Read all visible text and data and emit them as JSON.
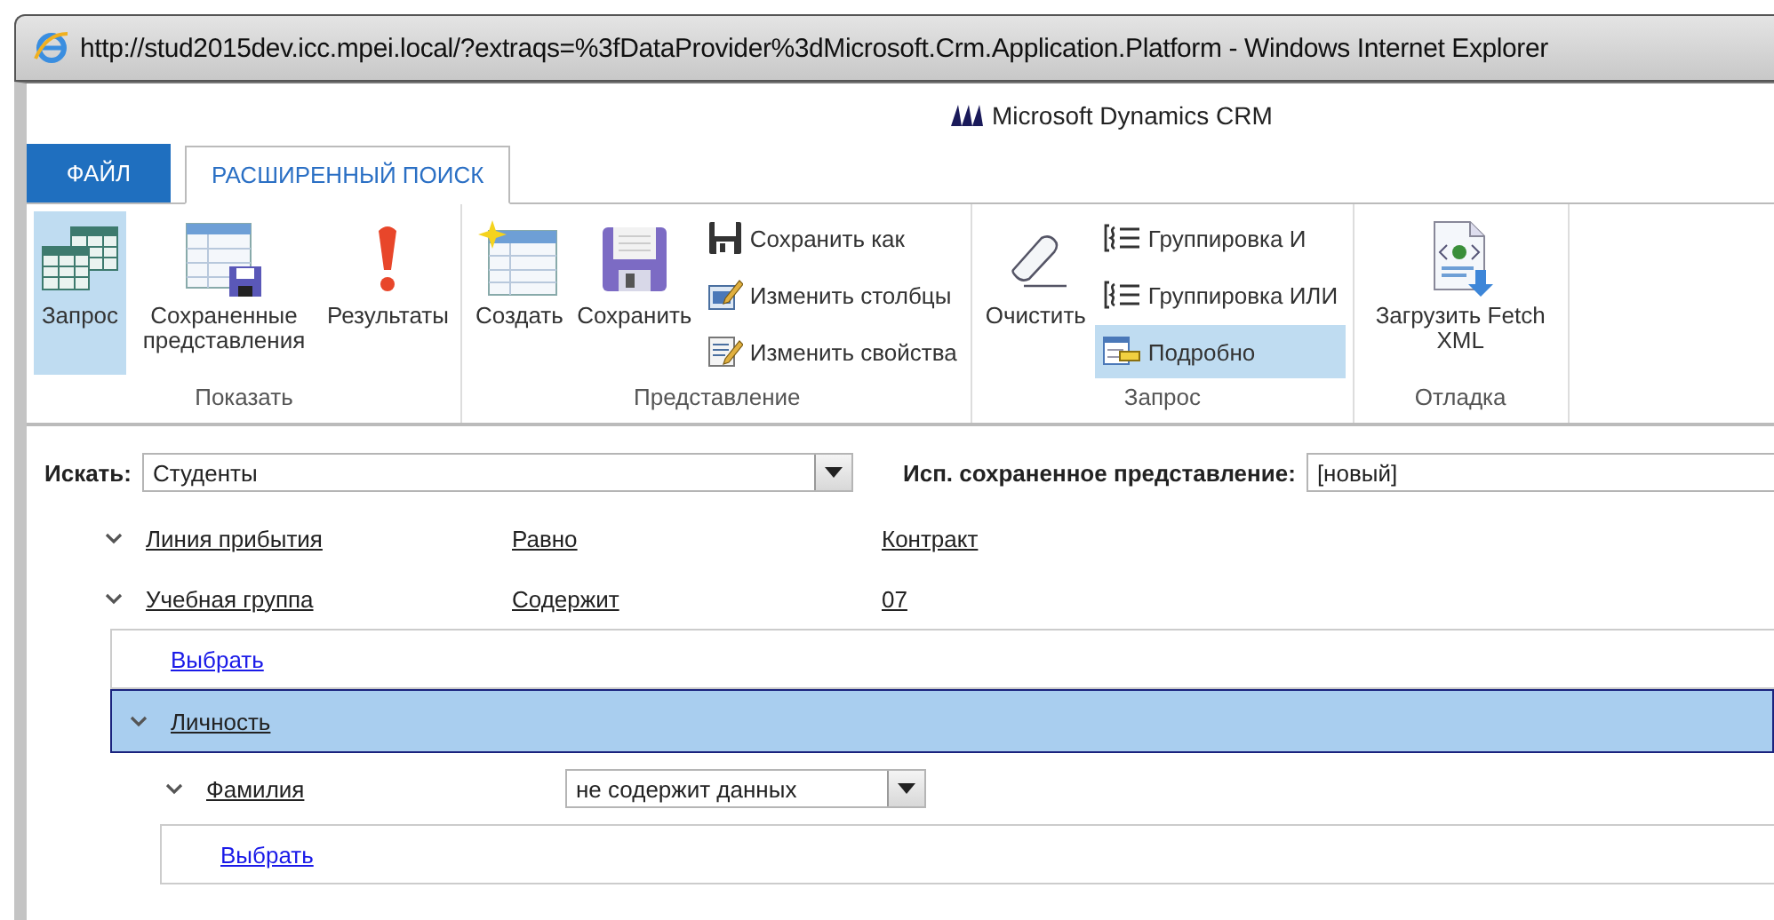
{
  "window": {
    "title": "http://stud2015dev.icc.mpei.local/?extraqs=%3fDataProvider%3dMicrosoft.Crm.Application.Platform - Windows Internet Explorer"
  },
  "header": {
    "logo": "Microsoft Dynamics CRM"
  },
  "tabs": [
    {
      "label": "ФАЙЛ",
      "kind": "file",
      "selected": false
    },
    {
      "label": "РАСШИРЕННЫЙ ПОИСК",
      "kind": "tab",
      "selected": true
    }
  ],
  "ribbon": {
    "groups": [
      {
        "label": "Показать",
        "buttons": [
          {
            "kind": "large",
            "label": "Запрос",
            "selected": true
          },
          {
            "kind": "large",
            "label": "Сохраненные представления",
            "selected": false
          },
          {
            "kind": "large",
            "label": "Результаты",
            "selected": false
          }
        ]
      },
      {
        "label": "Представление",
        "buttons": [
          {
            "kind": "large",
            "label": "Создать",
            "selected": false
          },
          {
            "kind": "large",
            "label": "Сохранить",
            "selected": false
          },
          {
            "kind": "small",
            "label": "Сохранить как",
            "selected": false
          },
          {
            "kind": "small",
            "label": "Изменить столбцы",
            "selected": false
          },
          {
            "kind": "small",
            "label": "Изменить свойства",
            "selected": false
          }
        ]
      },
      {
        "label": "Запрос",
        "buttons": [
          {
            "kind": "large",
            "label": "Очистить",
            "selected": false
          },
          {
            "kind": "small",
            "label": "Группировка И",
            "selected": false
          },
          {
            "kind": "small",
            "label": "Группировка ИЛИ",
            "selected": false
          },
          {
            "kind": "small",
            "label": "Подробно",
            "selected": true
          }
        ]
      },
      {
        "label": "Отладка",
        "buttons": [
          {
            "kind": "large",
            "label": "Загрузить Fetch XML",
            "selected": false
          }
        ]
      }
    ]
  },
  "search": {
    "label": "Искать:",
    "value": "Студенты",
    "saved_view_label": "Исп. сохраненное представление:",
    "saved_view_value": "[новый]"
  },
  "query": {
    "rows": [
      {
        "kind": "link",
        "field": "Линия прибытия",
        "operator": "Равно",
        "value": "Контракт"
      },
      {
        "kind": "link",
        "field": "Учебная группа",
        "operator": "Содержит",
        "value": "07"
      }
    ],
    "select_link": "Выбрать",
    "related": [
      {
        "entity": "Личность",
        "selected": true,
        "rows": [
          {
            "kind": "dropdown",
            "field": "Фамилия",
            "operator": "не содержит данных"
          }
        ],
        "select_link": "Выбрать"
      }
    ]
  }
}
